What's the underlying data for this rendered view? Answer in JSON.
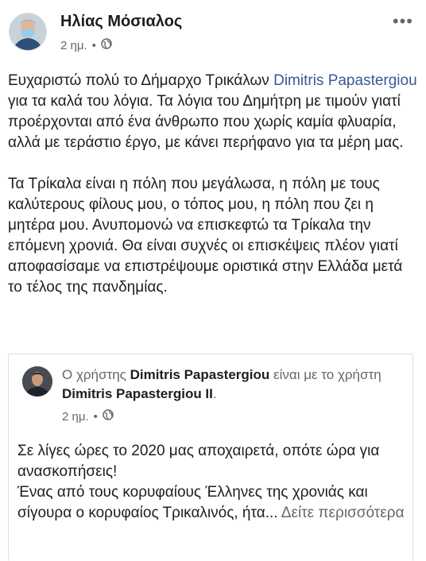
{
  "post": {
    "author": "Ηλίας Μόσιαλος",
    "time": "2 ημ.",
    "separator": "•",
    "privacy_icon": "globe-icon",
    "more_icon": "more-options-icon",
    "more_label": "•••",
    "paragraph1": {
      "t1": "Ευχαριστώ πολύ το Δήμαρχο Τρικάλων ",
      "mention": "Dimitris Papastergiou",
      "t2": " για τα καλά του λόγια. Τα λόγια του Δημήτρη με τιμούν γιατί προέρχονται από ένα άνθρωπο που χωρίς καμία φλυαρία, αλλά με τεράστιο έργο, με κάνει περήφανο για τα μέρη μας."
    },
    "paragraph2": "Τα Τρίκαλα είναι η πόλη που μεγάλωσα, η πόλη με τους καλύτερους φίλους μου, ο τόπος μου, η πόλη που ζει η μητέρα μου. Ανυπομονώ να επισκεφτώ τα Τρίκαλα την επόμενη χρονιά. Θα είναι συχνές οι επισκέψεις πλέον γιατί αποφασίσαμε να επιστρέψουμε οριστικά στην Ελλάδα μετά το τέλος της πανδημίας."
  },
  "shared": {
    "prefix": "Ο χρήστης ",
    "user1": "Dimitris Papastergiou",
    "middle": " είναι με το χρήστη ",
    "user2": "Dimitris Papastergiou II",
    "suffix": ".",
    "time": "2 ημ.",
    "separator": "•",
    "privacy_icon": "globe-icon",
    "text_line1": "Σε λίγες ώρες το 2020 μας αποχαιρετά, οπότε ώρα για ανασκοπήσεις!",
    "text_line2": "Ένας από τους κορυφαίους Έλληνες της χρονιάς και σίγουρα ο κορυφαίος Τρικαλινός, ήτα...",
    "see_more": "Δείτε περισσότερα"
  }
}
